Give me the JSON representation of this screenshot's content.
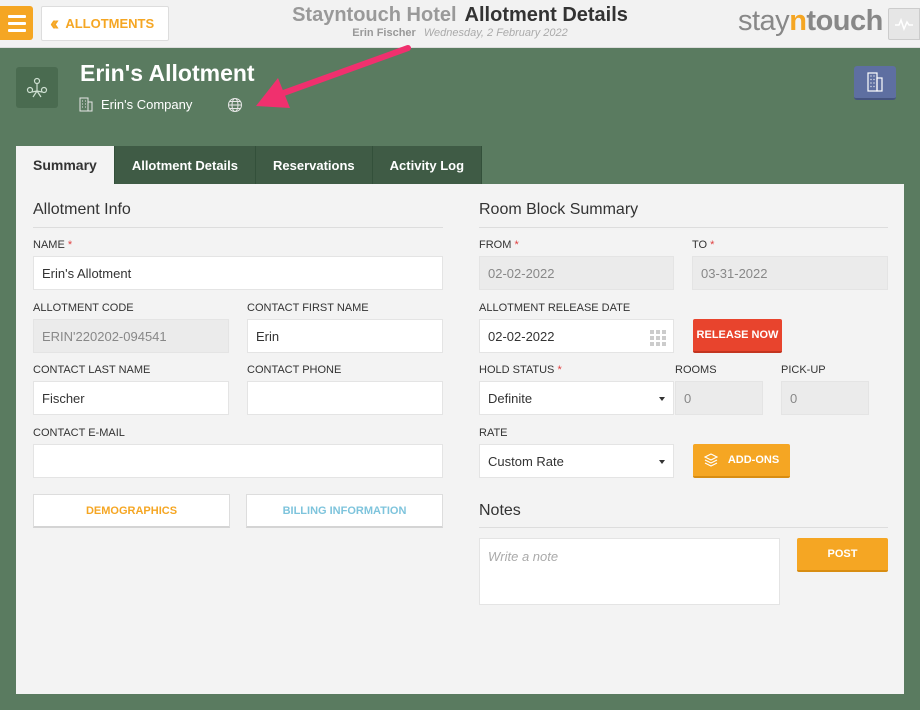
{
  "topbar": {
    "back_label": "ALLOTMENTS",
    "hotel_name": "Stayntouch Hotel",
    "page_title": "Allotment Details",
    "user_name": "Erin Fischer",
    "date": "Wednesday, 2 February 2022",
    "logo_stay": "stay",
    "logo_n": "n",
    "logo_touch": "touch"
  },
  "header": {
    "title": "Erin's Allotment",
    "company": "Erin's Company"
  },
  "tabs": [
    "Summary",
    "Allotment Details",
    "Reservations",
    "Activity Log"
  ],
  "allotment_info": {
    "title": "Allotment Info",
    "name_label": "NAME",
    "name_value": "Erin's Allotment",
    "code_label": "ALLOTMENT CODE",
    "code_value": "ERIN'220202-094541",
    "first_name_label": "CONTACT FIRST NAME",
    "first_name_value": "Erin",
    "last_name_label": "CONTACT LAST NAME",
    "last_name_value": "Fischer",
    "phone_label": "CONTACT PHONE",
    "phone_value": "",
    "email_label": "CONTACT E-MAIL",
    "email_value": "",
    "demographics_label": "DEMOGRAPHICS",
    "billing_label": "BILLING INFORMATION"
  },
  "room_block": {
    "title": "Room Block Summary",
    "from_label": "FROM",
    "from_value": "02-02-2022",
    "to_label": "TO",
    "to_value": "03-31-2022",
    "release_label": "ALLOTMENT RELEASE DATE",
    "release_value": "02-02-2022",
    "release_now_label": "RELEASE NOW",
    "hold_label": "HOLD STATUS",
    "hold_value": "Definite",
    "rooms_label": "ROOMS",
    "rooms_value": "0",
    "pickup_label": "PICK-UP",
    "pickup_value": "0",
    "rate_label": "RATE",
    "rate_value": "Custom Rate",
    "addons_label": "ADD-ONS"
  },
  "notes": {
    "title": "Notes",
    "placeholder": "Write a note",
    "post_label": "POST"
  },
  "required_mark": "*",
  "colors": {
    "accent": "#f5a623",
    "background": "#5a7b60",
    "tab_bg": "#3f5b45",
    "danger": "#e8442d",
    "hotel_btn": "#5e6fa1",
    "annotation_arrow": "#f0306e"
  }
}
